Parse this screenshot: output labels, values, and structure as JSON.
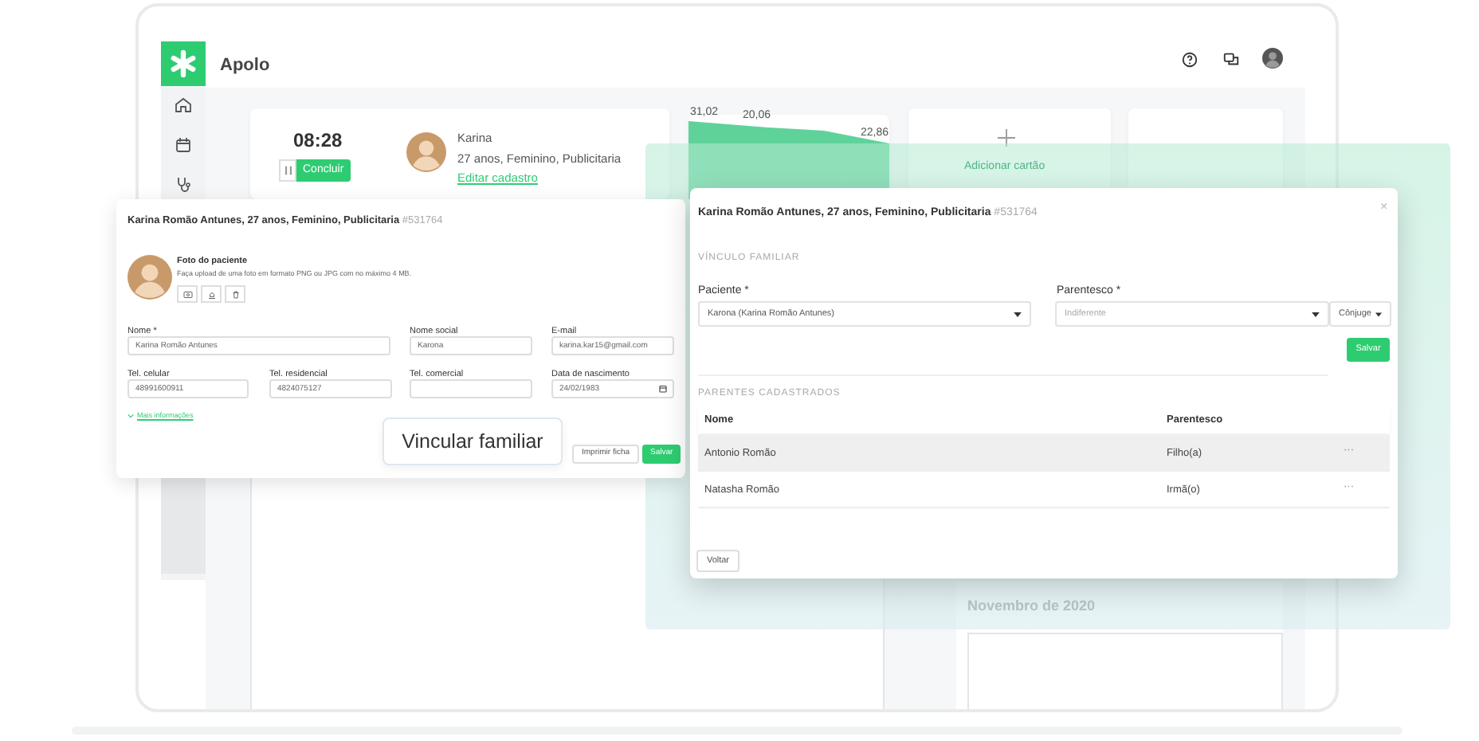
{
  "app": {
    "name": "Apolo"
  },
  "timer": {
    "time": "08:28",
    "finish_button": "Concluir"
  },
  "patient_card": {
    "name": "Karina",
    "details": "27 anos, Feminino, Publicitaria",
    "edit_link": "Editar cadastro"
  },
  "weight_chart": {
    "point_labels": [
      "31,02",
      "20,06",
      "22,86"
    ]
  },
  "add_card": {
    "label": "Adicionar cartão"
  },
  "patient_form": {
    "title": "Karina Romão Antunes, 27 anos, Feminino, Publicitaria",
    "record_id": "#531764",
    "photo": {
      "title": "Foto do paciente",
      "hint": "Faça upload de uma foto em formato PNG ou JPG com no máximo 4 MB."
    },
    "fields": [
      {
        "label": "Nome *",
        "value": "Karina Romão Antunes",
        "kind": "text"
      },
      {
        "label": "Nome social",
        "value": "Karona",
        "kind": "text"
      },
      {
        "label": "E-mail",
        "value": "karina.kar15@gmail.com",
        "kind": "text"
      },
      {
        "label": "Tel. celular",
        "value": "48991600911",
        "kind": "text"
      },
      {
        "label": "Tel. residencial",
        "value": "4824075127",
        "kind": "text"
      },
      {
        "label": "Tel. comercial",
        "kind": "text"
      },
      {
        "label": "Data de nascimento",
        "value": "24/02/1983",
        "kind": "date"
      }
    ],
    "more_link": "Mais informações",
    "buttons": [
      "Imprimir ficha",
      "Salvar"
    ]
  },
  "callout": {
    "label": "Vincular familiar"
  },
  "family_modal": {
    "title": "Karina Romão Antunes, 27 anos, Feminino, Publicitaria",
    "record_id": "#531764",
    "close": "×",
    "section": "VÍNCULO FAMILIAR",
    "patient_field": {
      "label": "Paciente *",
      "value": "Karona (Karina Romão Antunes)"
    },
    "relation_field": {
      "label": "Parentesco *",
      "placeholder": "Indiferente"
    },
    "relation_type": "Cônjuge",
    "save_button": "Salvar",
    "list_title": "PARENTES CADASTRADOS",
    "table": {
      "columns": [
        "Nome",
        "Parentesco"
      ],
      "rows": [
        {
          "name": "Antonio Romão",
          "relation": "Filho(a)",
          "actions": "···",
          "selected": true
        },
        {
          "name": "Natasha Romão",
          "relation": "Irmã(o)",
          "actions": "···",
          "selected": false
        }
      ]
    },
    "back_button": "Voltar"
  },
  "calendar": {
    "month": "Novembro de 2020"
  }
}
